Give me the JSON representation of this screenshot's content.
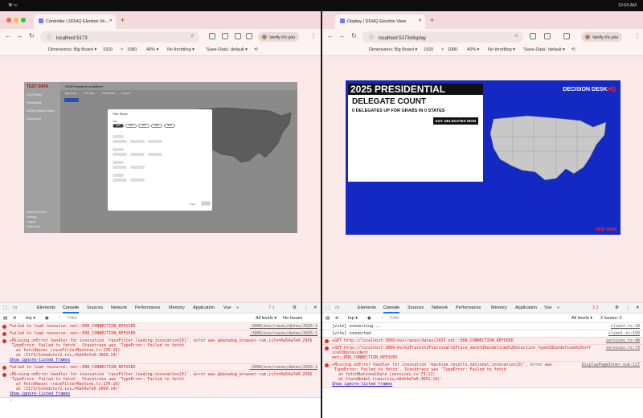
{
  "menubar": {
    "left": "⌘⌥",
    "right": "10:50 AM"
  },
  "left_window": {
    "tab_title": "Controller | DDHQ Election Ve...",
    "url": "localhost:5173",
    "verify_label": "Verify it's you",
    "device_bar": {
      "dimensions": "Dimensions: Big Board ▾",
      "width": "1920",
      "times": "×",
      "height": "1080",
      "zoom": "40% ▾",
      "throttle": "No throttling ▾",
      "save_data": "'Save-Data': default ▾"
    },
    "app": {
      "brand": "TEST DATA",
      "page_title": "2025 President: undefined",
      "sidebar_items": [
        "Live Results",
        "Presidential",
        "DDHQ Network States",
        "Scoreboard"
      ],
      "sidebar_bottom": [
        "Display Preview",
        "Settings",
        "Logout",
        "Dark mode"
      ],
      "subtabs": [
        "Map Tools",
        "Poll Stats",
        "Model Stats",
        "Preview"
      ],
      "modal": {
        "title": "Filter Races",
        "year_label": "Year",
        "years": [
          "2025",
          "2024",
          "2023",
          "2022",
          "2020"
        ],
        "clear": "Clear",
        "apply": "Apply"
      }
    },
    "devtools": {
      "tabs": [
        "Elements",
        "Console",
        "Sources",
        "Network",
        "Performance",
        "Memory",
        "Application",
        "Vue",
        "»"
      ],
      "badges": "7  1",
      "context": "top ▾",
      "filter_placeholder": "Filter",
      "levels": "All levels ▾",
      "issues": "No Issues",
      "logs": [
        {
          "type": "err",
          "text": "Failed to load resource: net::ERR_CONNECTION_REFUSED",
          "src": ":3006/evs/races/dates/2025:1"
        },
        {
          "type": "err",
          "text": "Failed to load resource: net::ERR_CONNECTION_REFUSED",
          "src": ":3006/evs/races/dates/2025:1"
        },
        {
          "type": "err",
          "text": "▸Missing onError handler for invocation 'raceFilter.loading:invocation[0]', error was  @datadog_browser-rum.js?v=0a54a7e0:2956",
          "l2": "'TypeError: Failed to fetch'. Stacktrace was 'TypeError: Failed to fetch",
          "l3": "at fetchRaces (raceFilterMachine.ts:170:16)",
          "l4": "at :5173/Scheduler2.ini…=0a54a7e0:1669:14)'",
          "l5": "Show ignore-listed frames"
        },
        {
          "type": "err",
          "text": "Failed to load resource: net::ERR_CONNECTION_REFUSED",
          "src": ":3006/evs/races/dates/2025:1"
        },
        {
          "type": "err",
          "text": "▸Missing onError handler for invocation 'raceFilter.loading:invocation[0]', error was  @datadog_browser-rum.js?v=0a54a7e0:2956",
          "l2": "'TypeError: Failed to fetch'. Stacktrace was 'TypeError: Failed to fetch",
          "l3": "at fetchRaces (raceFilterMachine.ts:170:16)",
          "l4": "at :5173/Scheduler2.ini…=0a54a7e0:1669:14)'",
          "l5": "Show ignore-listed frames"
        }
      ]
    }
  },
  "right_window": {
    "tab_title": "Display | DDHQ Election View",
    "url": "localhost:5173/display",
    "verify_label": "Verify it's you",
    "device_bar": {
      "dimensions": "Dimensions: Big Board ▾",
      "width": "1920",
      "times": "×",
      "height": "1080",
      "zoom": "40% ▾",
      "throttle": "No throttling ▾",
      "save_data": "'Save-Data': default ▾"
    },
    "app": {
      "title": "2025 PRESIDENTIAL",
      "subtitle": "DELEGATE COUNT",
      "delegates_line": "0 DELEGATES UP FOR GRABS IN 0 STATES",
      "est_label": "EST. DELEGATES WON",
      "logo": "DECISION DESK",
      "logo_accent": "HQ",
      "test_data": "TEST DATA"
    },
    "devtools": {
      "tabs": [
        "Elements",
        "Console",
        "Sources",
        "Network",
        "Performance",
        "Memory",
        "Application",
        "Vue",
        "»"
      ],
      "badges": "3  2",
      "context": "top ▾",
      "filter_placeholder": "Filter",
      "levels": "All levels ▾",
      "issues": "2 Issues: 2",
      "logs": [
        {
          "type": "plain",
          "text": "[vite] connecting...",
          "src": "client.ts:18"
        },
        {
          "type": "plain",
          "text": "[vite] connected.",
          "src": "client.ts:150"
        },
        {
          "type": "err",
          "text": "▸GET http://localhost:3006/evs/races/dates/2025 net::ERR_CONNECTION_REFUSED",
          "src": "services.ts:48"
        },
        {
          "type": "err",
          "text": "▸GET http://localhost:3006/mvs%2Fraces%2Fnational%2Frace_date%3Dundefined%26election_type%3Dundefined%26office%3Dpresident",
          "l2": "net::ERR_CONNECTION_REFUSED",
          "src": "services.ts:73"
        },
        {
          "type": "err",
          "text": "▸Missing onError handler for invocation 'machine.results.national:invocation[0]', error was",
          "l2": "'TypeError: Failed to fetch'. Stacktrace was 'TypeError: Failed to fetch",
          "l3": "at fetchNationalData (services.ts:73:12)",
          "l4": "at StateNode2.transitio…=0a54a7e0:3651:19)'",
          "l5": "Show ignore-listed frames",
          "src": "DisplayPageInner.vue:117"
        }
      ]
    }
  }
}
